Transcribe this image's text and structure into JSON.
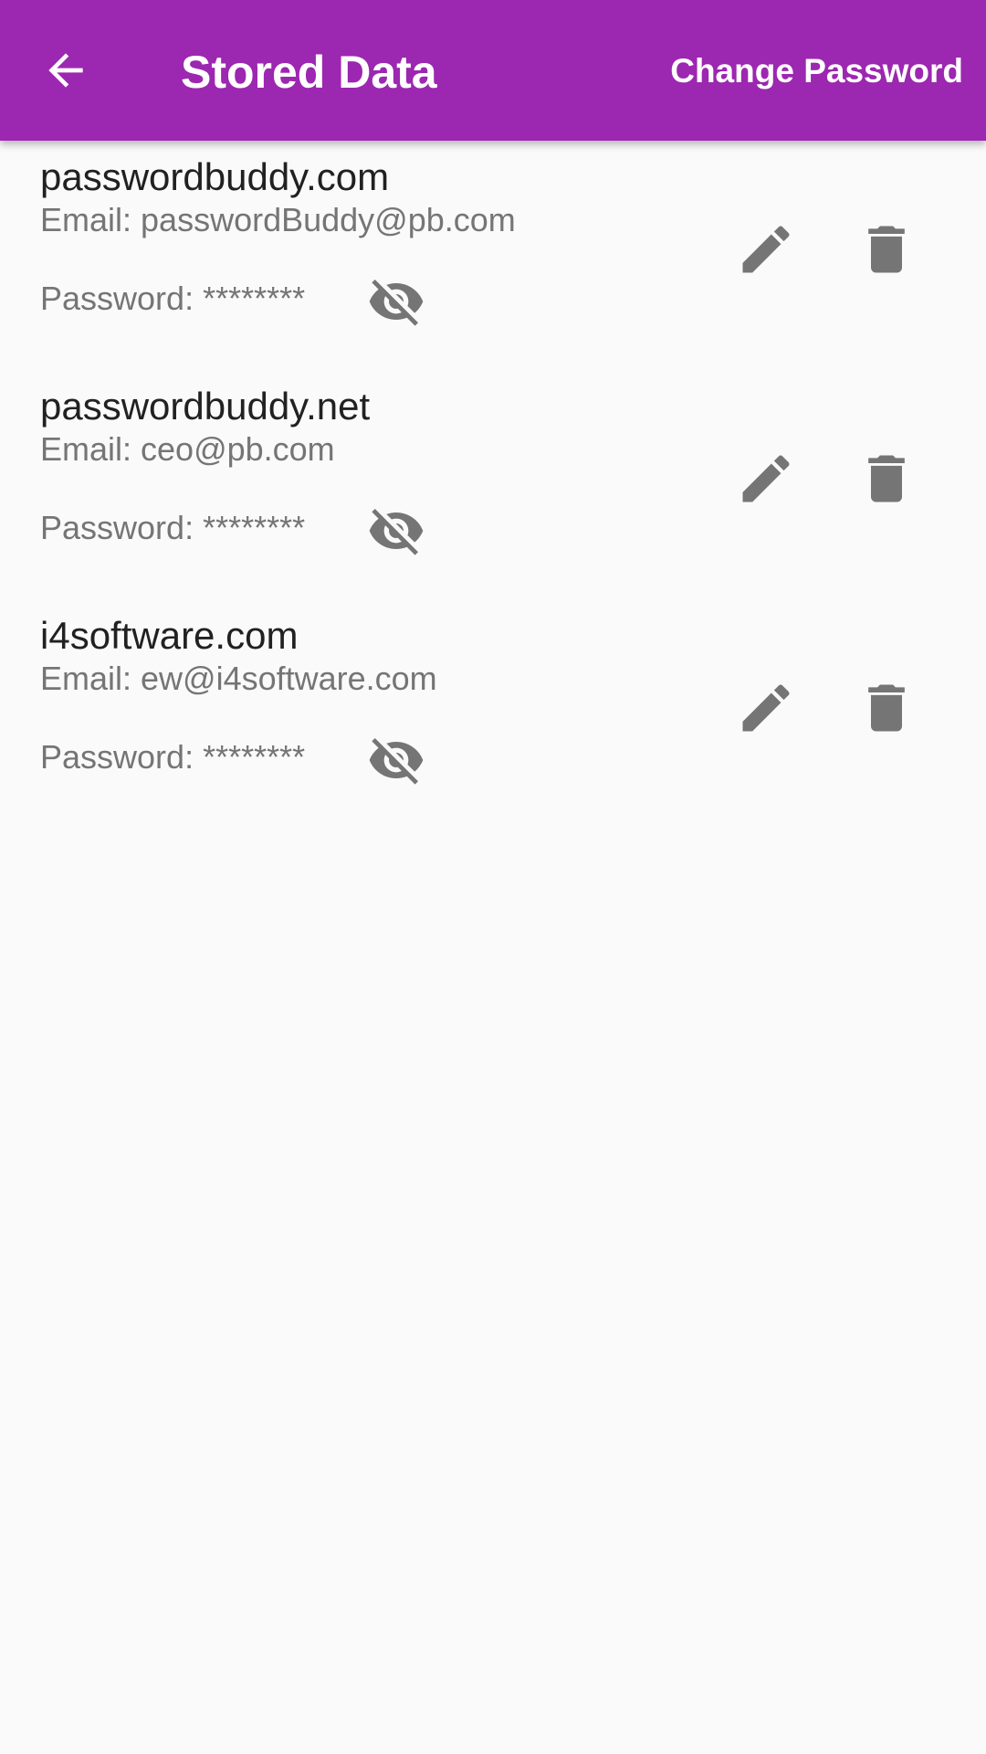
{
  "appbar": {
    "title": "Stored Data",
    "action_label": "Change Password",
    "background_color": "#9c27b0",
    "back_icon": "arrow-back-icon"
  },
  "entries": [
    {
      "site": "passwordbuddy.com",
      "email": "Email: passwordBuddy@pb.com",
      "password": "Password: ********",
      "visibility_icon": "visibility-off-icon",
      "edit_icon": "edit-icon",
      "delete_icon": "delete-icon"
    },
    {
      "site": "passwordbuddy.net",
      "email": "Email: ceo@pb.com",
      "password": "Password: ********",
      "visibility_icon": "visibility-off-icon",
      "edit_icon": "edit-icon",
      "delete_icon": "delete-icon"
    },
    {
      "site": "i4software.com",
      "email": "Email: ew@i4software.com",
      "password": "Password: ********",
      "visibility_icon": "visibility-off-icon",
      "edit_icon": "edit-icon",
      "delete_icon": "delete-icon"
    }
  ],
  "colors": {
    "icon_gray": "#757575",
    "primary_text": "#212121",
    "secondary_text": "#757575",
    "background": "#fafafa"
  }
}
